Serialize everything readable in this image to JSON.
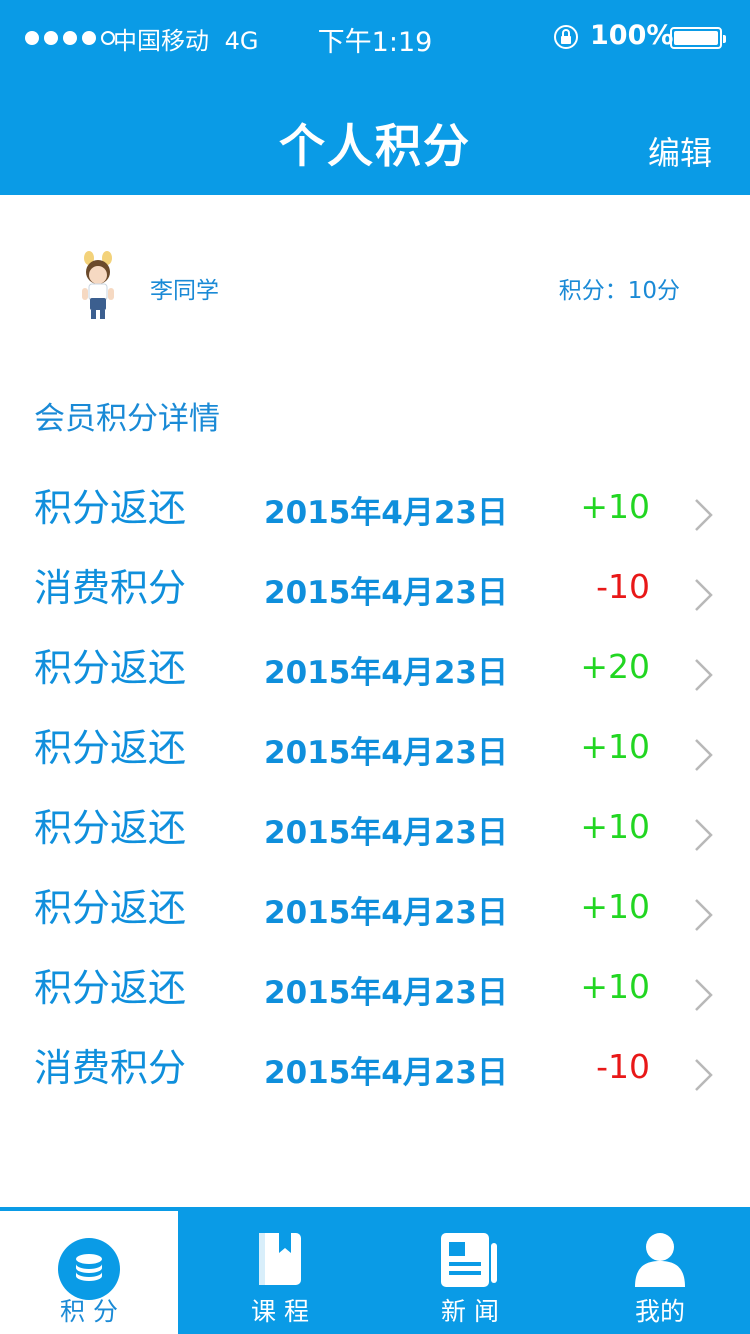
{
  "status_bar": {
    "carrier": "中国移动",
    "network": "4G",
    "time": "下午1:19",
    "battery": "100%"
  },
  "header": {
    "title": "个人积分",
    "edit_label": "编辑"
  },
  "profile": {
    "name": "李同学",
    "points_label": "积分：10分"
  },
  "section_title": "会员积分详情",
  "records": [
    {
      "type": "积分返还",
      "date": "2015年4月23日",
      "amount": "+10",
      "sign": "pos"
    },
    {
      "type": "消费积分",
      "date": "2015年4月23日",
      "amount": "-10",
      "sign": "neg"
    },
    {
      "type": "积分返还",
      "date": "2015年4月23日",
      "amount": "+20",
      "sign": "pos"
    },
    {
      "type": "积分返还",
      "date": "2015年4月23日",
      "amount": "+10",
      "sign": "pos"
    },
    {
      "type": "积分返还",
      "date": "2015年4月23日",
      "amount": "+10",
      "sign": "pos"
    },
    {
      "type": "积分返还",
      "date": "2015年4月23日",
      "amount": "+10",
      "sign": "pos"
    },
    {
      "type": "积分返还",
      "date": "2015年4月23日",
      "amount": "+10",
      "sign": "pos"
    },
    {
      "type": "消费积分",
      "date": "2015年4月23日",
      "amount": "-10",
      "sign": "neg"
    }
  ],
  "tabs": [
    {
      "label": "积 分",
      "icon": "coins-icon",
      "active": true
    },
    {
      "label": "课 程",
      "icon": "book-icon",
      "active": false
    },
    {
      "label": "新 闻",
      "icon": "newspaper-icon",
      "active": false
    },
    {
      "label": "我的",
      "icon": "user-icon",
      "active": false
    }
  ],
  "colors": {
    "primary": "#0a9be6",
    "text_blue": "#1a8ad6",
    "positive": "#22d622",
    "negative": "#e81818"
  }
}
